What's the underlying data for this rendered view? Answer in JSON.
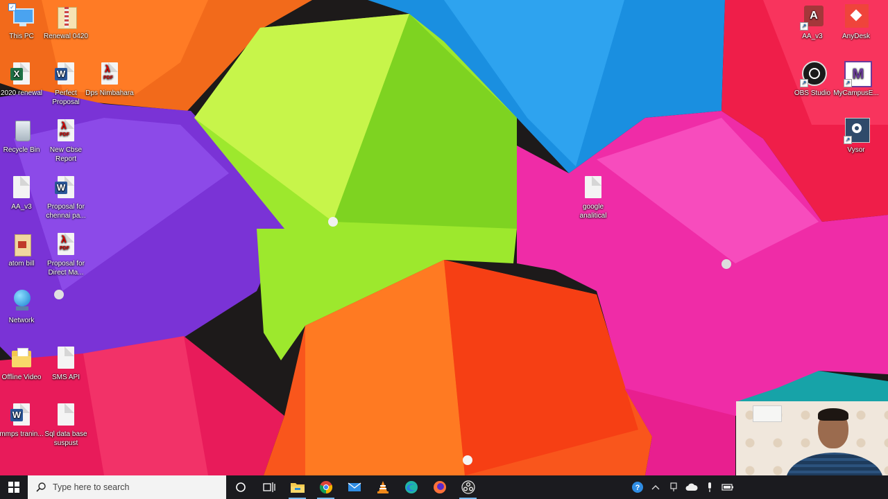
{
  "desktop": {
    "icons": [
      {
        "id": "this-pc",
        "label": "This PC"
      },
      {
        "id": "renewal",
        "label": "Renewal 0420"
      },
      {
        "id": "2020-renewal",
        "label": "2020 renewal"
      },
      {
        "id": "perfect-proposal",
        "label": "Perfect Proposal"
      },
      {
        "id": "dps-nimbahara",
        "label": "Dps Nimbahara"
      },
      {
        "id": "recycle-bin",
        "label": "Recycle Bin"
      },
      {
        "id": "new-cbse-report",
        "label": "New Cbse Report"
      },
      {
        "id": "aa-v3-file",
        "label": "AA_v3"
      },
      {
        "id": "proposal-chennai",
        "label": "Proposal for chennai pa..."
      },
      {
        "id": "atom-bill",
        "label": "atom bill"
      },
      {
        "id": "proposal-direct",
        "label": "Proposal for Direct Ma..."
      },
      {
        "id": "network",
        "label": "Network"
      },
      {
        "id": "offline-video",
        "label": "Offline Video"
      },
      {
        "id": "sms-api",
        "label": "SMS API"
      },
      {
        "id": "mmps-training",
        "label": "mmps tranin..."
      },
      {
        "id": "sql-database",
        "label": "Sql data base suspust"
      },
      {
        "id": "google-analytical",
        "label": "google analitical"
      },
      {
        "id": "aa-v3-app",
        "label": "AA_v3"
      },
      {
        "id": "anydesk",
        "label": "AnyDesk"
      },
      {
        "id": "obs-studio",
        "label": "OBS Studio"
      },
      {
        "id": "mycampus",
        "label": "MyCampusE..."
      },
      {
        "id": "vysor",
        "label": "Vysor"
      }
    ]
  },
  "taskbar": {
    "search_placeholder": "Type here to search",
    "pinned": [
      "file-explorer",
      "chrome",
      "mail",
      "vlc",
      "edge",
      "firefox",
      "obs"
    ],
    "tray": [
      "help",
      "chevron-up",
      "network",
      "onedrive",
      "microphone",
      "battery"
    ]
  },
  "colors": {
    "taskbar_bg": "#1b1b1f",
    "active_indicator": "#76b9ed"
  }
}
